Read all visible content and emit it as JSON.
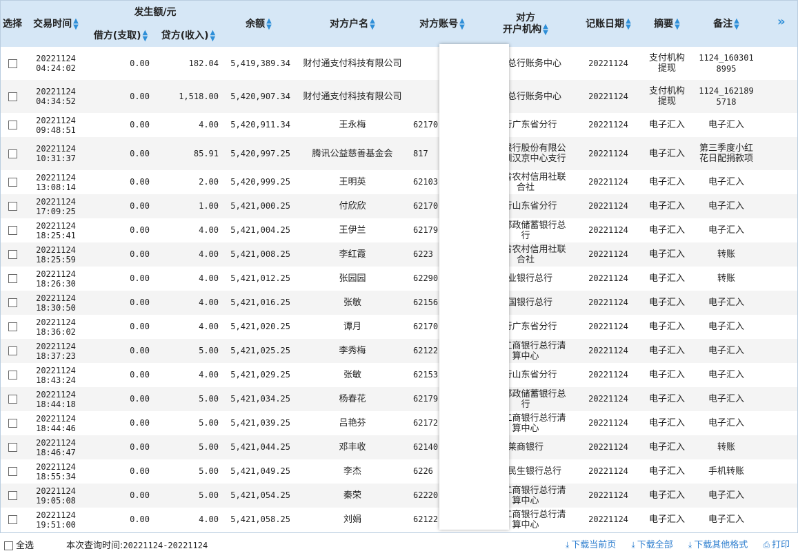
{
  "header": {
    "select": "选择",
    "time": "交易时间",
    "amount_group": "发生额/元",
    "debit": "借方(支取)",
    "credit": "贷方(收入)",
    "balance": "余额",
    "counter_name": "对方户名",
    "counter_account": "对方账号",
    "counter_bank_line1": "对方",
    "counter_bank_line2": "开户机构",
    "post_date": "记账日期",
    "summary": "摘要",
    "remark": "备注"
  },
  "rows": [
    {
      "date": "20221124",
      "time": "04:24:02",
      "debit": "0.00",
      "credit": "182.04",
      "balance": "5,419,389.34",
      "name": "财付通支付科技有限公司",
      "account": "",
      "bank": "建行总行账务中心",
      "post": "20221124",
      "summary": "支付机构提现",
      "remark": "1124_1603018995"
    },
    {
      "date": "20221124",
      "time": "04:34:52",
      "debit": "0.00",
      "credit": "1,518.00",
      "balance": "5,420,907.34",
      "name": "财付通支付科技有限公司",
      "account": "",
      "bank": "建行总行账务中心",
      "post": "20221124",
      "summary": "支付机构提现",
      "remark": "1124_1621895718"
    },
    {
      "date": "20221124",
      "time": "09:48:51",
      "debit": "0.00",
      "credit": "4.00",
      "balance": "5,420,911.34",
      "name": "王永梅",
      "account": "62170",
      "bank": "建行广东省分行",
      "post": "20221124",
      "summary": "电子汇入",
      "remark": "电子汇入"
    },
    {
      "date": "20221124",
      "time": "10:31:37",
      "debit": "0.00",
      "credit": "85.91",
      "balance": "5,420,997.25",
      "name": "腾讯公益慈善基金会",
      "account": "817",
      "bank": "招商银行股份有限公司深圳汉京中心支行",
      "post": "20221124",
      "summary": "电子汇入",
      "remark": "第三季度小红花日配捐款项"
    },
    {
      "date": "20221124",
      "time": "13:08:14",
      "debit": "0.00",
      "credit": "2.00",
      "balance": "5,420,999.25",
      "name": "王明英",
      "account": "62103",
      "bank": "四川省农村信用社联合社",
      "post": "20221124",
      "summary": "电子汇入",
      "remark": "电子汇入"
    },
    {
      "date": "20221124",
      "time": "17:09:25",
      "debit": "0.00",
      "credit": "1.00",
      "balance": "5,421,000.25",
      "name": "付欣欣",
      "account": "62170",
      "bank": "建行山东省分行",
      "post": "20221124",
      "summary": "电子汇入",
      "remark": "电子汇入"
    },
    {
      "date": "20221124",
      "time": "18:25:41",
      "debit": "0.00",
      "credit": "4.00",
      "balance": "5,421,004.25",
      "name": "王伊兰",
      "account": "62179",
      "bank": "中国邮政储蓄银行总行",
      "post": "20221124",
      "summary": "电子汇入",
      "remark": "电子汇入"
    },
    {
      "date": "20221124",
      "time": "18:25:59",
      "debit": "0.00",
      "credit": "4.00",
      "balance": "5,421,008.25",
      "name": "李红霞",
      "account": "6223",
      "bank": "山东省农村信用社联合社",
      "post": "20221124",
      "summary": "电子汇入",
      "remark": "转账"
    },
    {
      "date": "20221124",
      "time": "18:26:30",
      "debit": "0.00",
      "credit": "4.00",
      "balance": "5,421,012.25",
      "name": "张园园",
      "account": "62290",
      "bank": "兴业银行总行",
      "post": "20221124",
      "summary": "电子汇入",
      "remark": "转账"
    },
    {
      "date": "20221124",
      "time": "18:30:50",
      "debit": "0.00",
      "credit": "4.00",
      "balance": "5,421,016.25",
      "name": "张敏",
      "account": "62156",
      "bank": "中国银行总行",
      "post": "20221124",
      "summary": "电子汇入",
      "remark": "电子汇入"
    },
    {
      "date": "20221124",
      "time": "18:36:02",
      "debit": "0.00",
      "credit": "4.00",
      "balance": "5,421,020.25",
      "name": "谭月",
      "account": "62170",
      "bank": "建行广东省分行",
      "post": "20221124",
      "summary": "电子汇入",
      "remark": "电子汇入"
    },
    {
      "date": "20221124",
      "time": "18:37:23",
      "debit": "0.00",
      "credit": "5.00",
      "balance": "5,421,025.25",
      "name": "李秀梅",
      "account": "62122",
      "bank": "中国工商银行总行清算中心",
      "post": "20221124",
      "summary": "电子汇入",
      "remark": "电子汇入"
    },
    {
      "date": "20221124",
      "time": "18:43:24",
      "debit": "0.00",
      "credit": "4.00",
      "balance": "5,421,029.25",
      "name": "张敏",
      "account": "62153",
      "bank": "建行山东省分行",
      "post": "20221124",
      "summary": "电子汇入",
      "remark": "电子汇入"
    },
    {
      "date": "20221124",
      "time": "18:44:18",
      "debit": "0.00",
      "credit": "5.00",
      "balance": "5,421,034.25",
      "name": "杨春花",
      "account": "62179",
      "bank": "中国邮政储蓄银行总行",
      "post": "20221124",
      "summary": "电子汇入",
      "remark": "电子汇入"
    },
    {
      "date": "20221124",
      "time": "18:44:46",
      "debit": "0.00",
      "credit": "5.00",
      "balance": "5,421,039.25",
      "name": "吕艳芬",
      "account": "62172",
      "bank": "中国工商银行总行清算中心",
      "post": "20221124",
      "summary": "电子汇入",
      "remark": "电子汇入"
    },
    {
      "date": "20221124",
      "time": "18:46:47",
      "debit": "0.00",
      "credit": "5.00",
      "balance": "5,421,044.25",
      "name": "邓丰收",
      "account": "62140",
      "bank": "莱商银行",
      "post": "20221124",
      "summary": "电子汇入",
      "remark": "转账"
    },
    {
      "date": "20221124",
      "time": "18:55:34",
      "debit": "0.00",
      "credit": "5.00",
      "balance": "5,421,049.25",
      "name": "李杰",
      "account": "6226",
      "bank": "中国民生银行总行",
      "post": "20221124",
      "summary": "电子汇入",
      "remark": "手机转账"
    },
    {
      "date": "20221124",
      "time": "19:05:08",
      "debit": "0.00",
      "credit": "5.00",
      "balance": "5,421,054.25",
      "name": "秦荣",
      "account": "62220",
      "bank": "中国工商银行总行清算中心",
      "post": "20221124",
      "summary": "电子汇入",
      "remark": "电子汇入"
    },
    {
      "date": "20221124",
      "time": "19:51:00",
      "debit": "0.00",
      "credit": "4.00",
      "balance": "5,421,058.25",
      "name": "刘娟",
      "account": "62122",
      "bank": "中国工商银行总行清算中心",
      "post": "20221124",
      "summary": "电子汇入",
      "remark": "电子汇入"
    }
  ],
  "footer": {
    "select_all": "全选",
    "query_label": "本次查询时间:",
    "query_range": "20221124-20221124",
    "download_current": "下载当前页",
    "download_all": "下载全部",
    "download_other": "下载其他格式",
    "print": "打印"
  },
  "icons": {
    "sort": "sort-arrows-icon",
    "more": "double-chevron-right-icon",
    "download": "download-icon",
    "print": "printer-icon"
  },
  "colors": {
    "header_bg": "#d6e7f6",
    "accent": "#2f8fd8",
    "link": "#2f7fcf"
  }
}
